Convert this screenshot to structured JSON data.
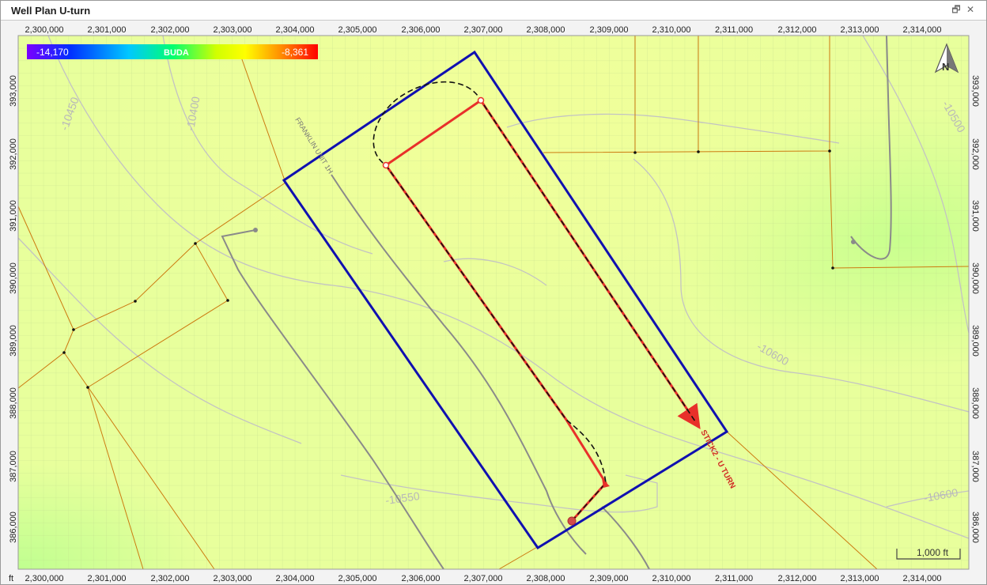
{
  "window": {
    "title": "Well Plan U-turn",
    "restore_glyph": "🗗",
    "close_glyph": "✕"
  },
  "x_axis": {
    "unit": "ft",
    "ticks": [
      "2,300,000",
      "2,301,000",
      "2,302,000",
      "2,303,000",
      "2,304,000",
      "2,305,000",
      "2,306,000",
      "2,307,000",
      "2,308,000",
      "2,309,000",
      "2,310,000",
      "2,311,000",
      "2,312,000",
      "2,313,000",
      "2,314,000"
    ]
  },
  "y_axis": {
    "ticks": [
      "393,000",
      "392,000",
      "391,000",
      "390,000",
      "389,000",
      "388,000",
      "387,000",
      "386,000"
    ]
  },
  "legend": {
    "min_label": "-14,170",
    "surface_label": "BUDA",
    "max_label": "-8,361",
    "colors": [
      "#7a00ff",
      "#0040ff",
      "#00c0ff",
      "#00ff60",
      "#c0ff00",
      "#ffff00",
      "#ff9000",
      "#ff0000"
    ]
  },
  "contours": [
    "-10450",
    "-10400",
    "-10500",
    "-10600",
    "-10550",
    "-10600"
  ],
  "wells": {
    "franklin": "FRANKLIN UNIT 1H",
    "stick": "STICK2 - U TURN"
  },
  "north": {
    "letter": "N",
    "icon": "north-arrow-icon"
  },
  "scale_bar": {
    "label": "1,000 ft"
  },
  "colors": {
    "boundary": "#1010b0",
    "plan_red": "#e8302a",
    "lease_lines": "#cc7a10",
    "map_bg": "#e6ff9a"
  }
}
